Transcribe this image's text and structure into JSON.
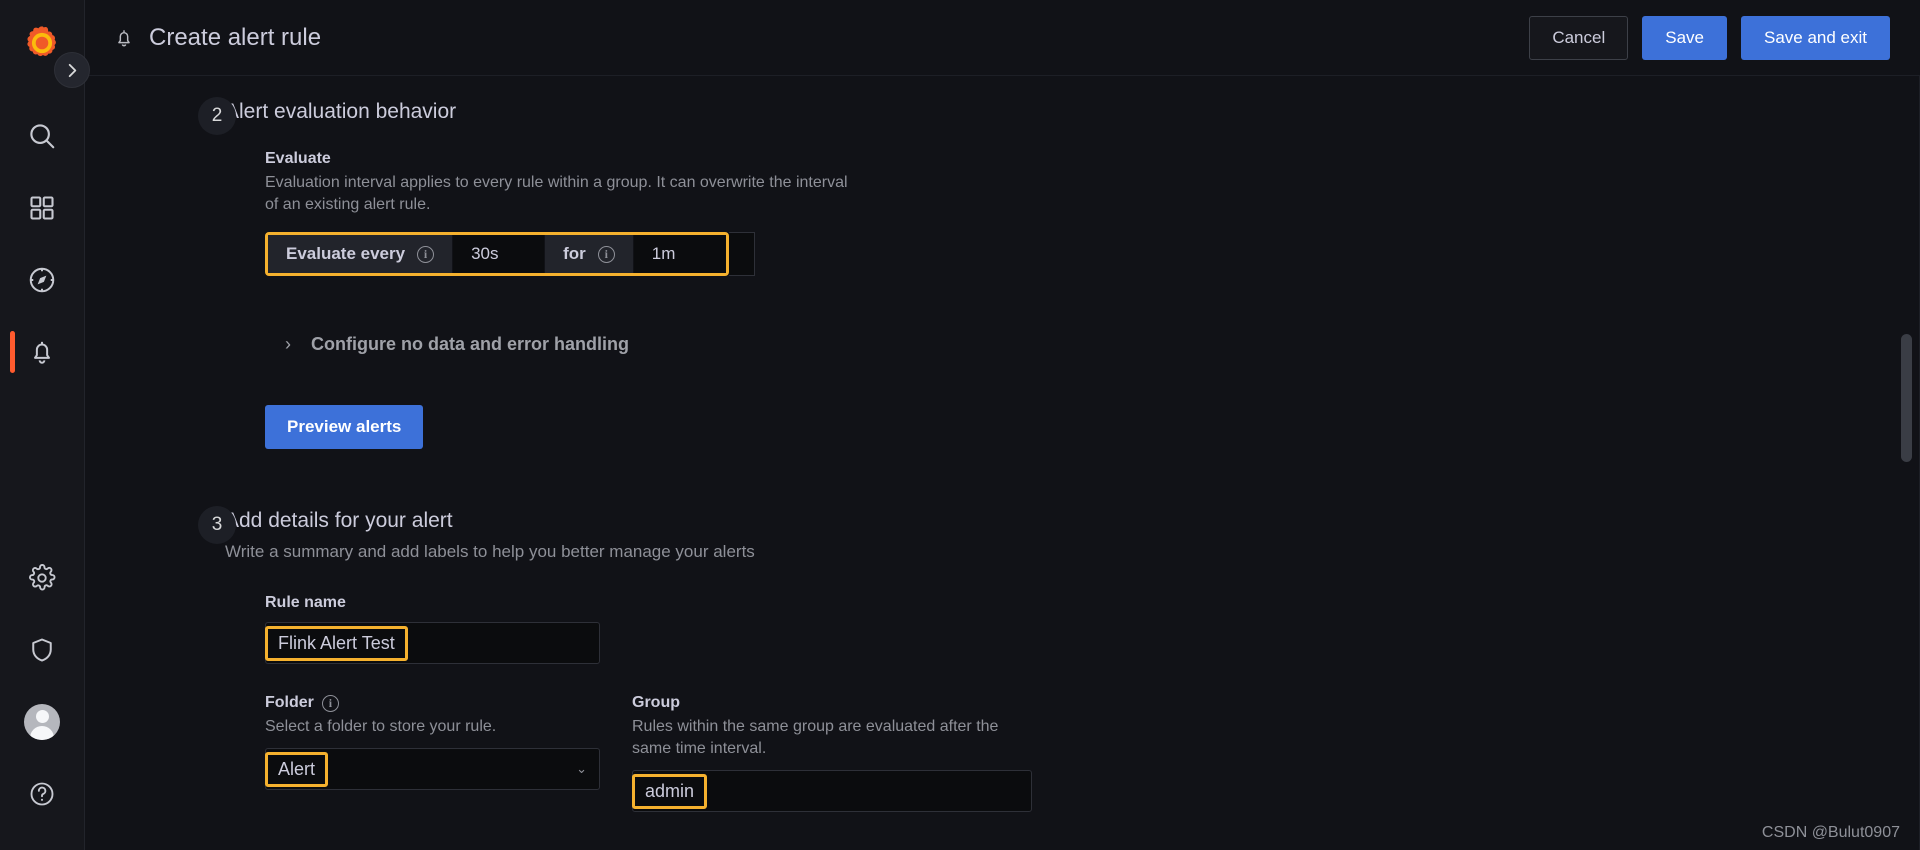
{
  "app": {
    "logo_name": "grafana-logo",
    "watermark": "CSDN @Bulut0907"
  },
  "sidebar": {
    "expand_label": "›",
    "items": [
      {
        "name": "search-icon",
        "label": "Search"
      },
      {
        "name": "dashboards-icon",
        "label": "Dashboards"
      },
      {
        "name": "explore-icon",
        "label": "Explore"
      },
      {
        "name": "alerting-icon",
        "label": "Alerting",
        "active": true
      }
    ],
    "bottom_items": [
      {
        "name": "gear-icon",
        "label": "Configuration"
      },
      {
        "name": "shield-icon",
        "label": "Server Admin"
      },
      {
        "name": "avatar",
        "label": "Profile"
      },
      {
        "name": "help-icon",
        "label": "Help"
      }
    ]
  },
  "header": {
    "bell_icon": "bell-icon",
    "title": "Create alert rule",
    "cancel_label": "Cancel",
    "save_label": "Save",
    "save_exit_label": "Save and exit"
  },
  "step2": {
    "number": "2",
    "title": "Alert evaluation behavior",
    "evaluate": {
      "label": "Evaluate",
      "description": "Evaluation interval applies to every rule within a group. It can overwrite the interval of an existing alert rule.",
      "every_label": "Evaluate every",
      "every_value": "30s",
      "for_label": "for",
      "for_value": "1m"
    },
    "collapse_label": "Configure no data and error handling",
    "collapse_chevron": "›",
    "preview_label": "Preview alerts"
  },
  "step3": {
    "number": "3",
    "title": "Add details for your alert",
    "description": "Write a summary and add labels to help you better manage your alerts",
    "rule_name": {
      "label": "Rule name",
      "value": "Flink Alert Test"
    },
    "folder": {
      "label": "Folder",
      "description": "Select a folder to store your rule.",
      "value": "Alert",
      "caret": "⌄"
    },
    "group": {
      "label": "Group",
      "description": "Rules within the same group are evaluated after the same time interval.",
      "value": "admin"
    }
  },
  "colors": {
    "accent_blue": "#3d71d9",
    "highlight_yellow": "#f5b12e",
    "active_orange": "#ff5b2e",
    "bg": "#111217"
  }
}
